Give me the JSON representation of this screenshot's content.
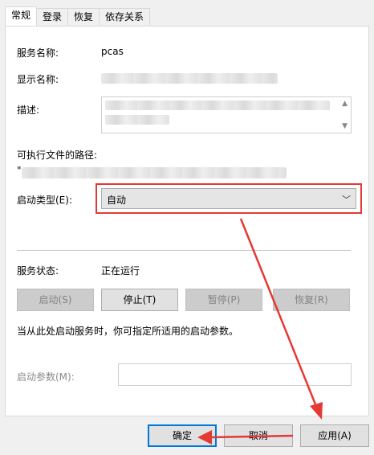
{
  "tabs": [
    {
      "label": "常规",
      "active": true
    },
    {
      "label": "登录"
    },
    {
      "label": "恢复"
    },
    {
      "label": "依存关系"
    }
  ],
  "general": {
    "service_name_label": "服务名称:",
    "service_name_value": "pcas",
    "display_name_label": "显示名称:",
    "description_label": "描述:",
    "path_label": "可执行文件的路径:",
    "path_prefix": "\"",
    "startup_type_label": "启动类型(E):",
    "startup_type_value": "自动",
    "status_label": "服务状态:",
    "status_value": "正在运行",
    "hint_text": "当从此处启动服务时，你可指定所适用的启动参数。",
    "start_params_label": "启动参数(M):"
  },
  "service_buttons": {
    "start": "启动(S)",
    "stop": "停止(T)",
    "pause": "暂停(P)",
    "resume": "恢复(R)"
  },
  "footer_buttons": {
    "ok": "确定",
    "cancel": "取消",
    "apply": "应用(A)"
  },
  "colors": {
    "annotation_red": "#e53935",
    "focus_blue": "#0078d7"
  }
}
